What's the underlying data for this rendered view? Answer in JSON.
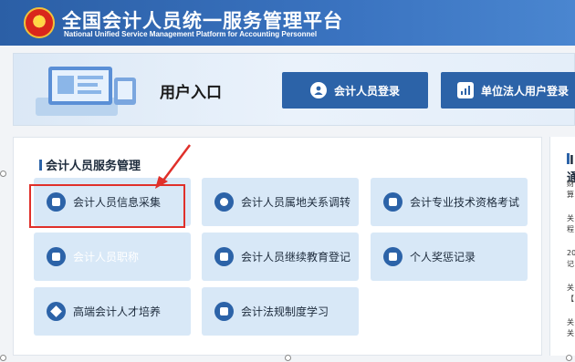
{
  "header": {
    "title_cn": "全国会计人员统一服务管理平台",
    "title_en": "National Unified Service Management Platform for Accounting Personnel"
  },
  "banner": {
    "entry_label": "用户入口",
    "accountant_login": "会计人员登录",
    "unit_login": "单位法人用户登录"
  },
  "services": {
    "section_title": "会计人员服务管理",
    "items": [
      {
        "label": "会计人员信息采集",
        "icon": "edit-icon"
      },
      {
        "label": "会计人员属地关系调转",
        "icon": "user-transfer-icon"
      },
      {
        "label": "会计专业技术资格考试",
        "icon": "exam-icon"
      },
      {
        "label": "会计人员职称",
        "icon": "title-icon"
      },
      {
        "label": "会计人员继续教育登记",
        "icon": "education-icon"
      },
      {
        "label": "个人奖惩记录",
        "icon": "record-icon"
      },
      {
        "label": "高端会计人才培养",
        "icon": "graduation-cap-icon"
      },
      {
        "label": "会计法规制度学习",
        "icon": "play-icon"
      }
    ]
  },
  "right_panel": {
    "title": "I通",
    "items": [
      "财",
      "算",
      "关",
      "程",
      "20",
      "记",
      "关",
      "【",
      "关",
      "关"
    ]
  },
  "colors": {
    "header_blue": "#2b5fa6",
    "button_blue": "#2c63a8",
    "service_bg": "#d8e8f7",
    "highlight_red": "#e0302a"
  }
}
